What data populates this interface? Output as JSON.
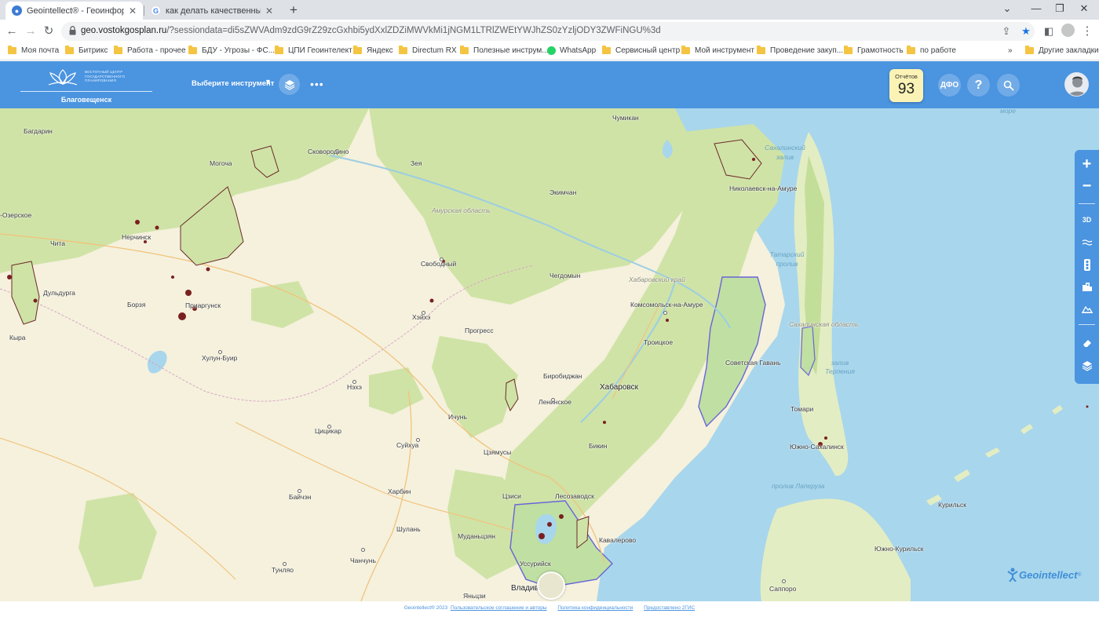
{
  "browser": {
    "tabs": [
      {
        "label": "Geointellect® - Геоинформацио",
        "active": true
      },
      {
        "label": "как делать качественные снимк",
        "active": false
      }
    ],
    "new_tab": "+",
    "url_host": "geo.vostokgosplan.ru",
    "url_rest": "/?sessiondata=di5sZWVAdm9zdG9rZ29zcGxhbi5ydXxlZDZiMWVkMi1jNGM1LTRlZWEtYWJhZS0zYzljODY3ZWFiNGU%3d",
    "bookmarks": [
      "Моя почта",
      "Битрикс",
      "Работа - прочее",
      "БДУ - Угрозы - ФС...",
      "ЦПИ Геоинтелект",
      "Яндекс",
      "Directum RX",
      "Полезные инструм...",
      "WhatsApp",
      "Сервисный центр",
      "Мой инструмент",
      "Проведение закуп...",
      "Грамотность",
      "по работе"
    ],
    "bookmarks_more": "»",
    "other_bookmarks": "Другие закладки"
  },
  "header": {
    "logo_text": [
      "ВОСТОЧНЫЙ ЦЕНТР",
      "ГОСУДАРСТВЕННОГО",
      "ПЛАНИРОВАНИЯ"
    ],
    "city": "Благовещенск",
    "tool_select": "Выберите инструмент",
    "tool_caret": "▼",
    "more": "•••",
    "reports_label": "Отчётов",
    "reports_count": "93",
    "region_button": "ДФО",
    "help_button": "?"
  },
  "map": {
    "places": [
      {
        "name": "Чумикан"
      },
      {
        "name": "Багдарин"
      },
      {
        "name": "Сковородино"
      },
      {
        "name": "Могоча"
      },
      {
        "name": "Зея"
      },
      {
        "name": "Экимчан"
      },
      {
        "name": "Николаевск-на-Амуре"
      },
      {
        "name": "Нерчинск"
      },
      {
        "name": "Чита"
      },
      {
        "name": "Свободный"
      },
      {
        "name": "Чегдомын"
      },
      {
        "name": "Дульдурга"
      },
      {
        "name": "Борзя"
      },
      {
        "name": "Приаргунск"
      },
      {
        "name": "Хэйхэ"
      },
      {
        "name": "Комсомольск-на-Амуре"
      },
      {
        "name": "Кыра"
      },
      {
        "name": "Прогресс"
      },
      {
        "name": "Троицкое"
      },
      {
        "name": "Хулун-Буир"
      },
      {
        "name": "Советская Гавань"
      },
      {
        "name": "Биробиджан"
      },
      {
        "name": "Хабаровск"
      },
      {
        "name": "Нэхэ"
      },
      {
        "name": "Ленинское"
      },
      {
        "name": "Ичунь"
      },
      {
        "name": "Томари"
      },
      {
        "name": "Цицикар"
      },
      {
        "name": "Бикин"
      },
      {
        "name": "Южно-Сахалинск"
      },
      {
        "name": "Суйхуа"
      },
      {
        "name": "Цзямусы"
      },
      {
        "name": "Харбин"
      },
      {
        "name": "Байчэн"
      },
      {
        "name": "Цзиси"
      },
      {
        "name": "Лесозаводск"
      },
      {
        "name": "Курильск"
      },
      {
        "name": "Шулань"
      },
      {
        "name": "Муданьцзян"
      },
      {
        "name": "Кавалерово"
      },
      {
        "name": "Южно-Курильск"
      },
      {
        "name": "Чанчунь"
      },
      {
        "name": "Уссурийск"
      },
      {
        "name": "Тунляо"
      },
      {
        "name": "Владивосток"
      },
      {
        "name": "Яньцзи"
      },
      {
        "name": "Саппоро"
      },
      {
        "name": "-Озерское"
      }
    ],
    "regions": [
      {
        "name": "Амурская область"
      },
      {
        "name": "Хабаровский край"
      },
      {
        "name": "Сахалинская область"
      }
    ],
    "waters": [
      {
        "name": "Сахалинский залив"
      },
      {
        "name": "Татарский пролив"
      },
      {
        "name": "залив Терпения"
      },
      {
        "name": "пролив Лаперуза"
      },
      {
        "name": "море"
      }
    ]
  },
  "brand": {
    "name": "Geointellect",
    "mark": "®"
  },
  "footer": {
    "copyright": "Geointellect® 2023",
    "links": [
      "Пользовательское соглашение и авторы",
      "Политика конфиденциальности",
      "Предоставлено 2ГИС"
    ]
  }
}
